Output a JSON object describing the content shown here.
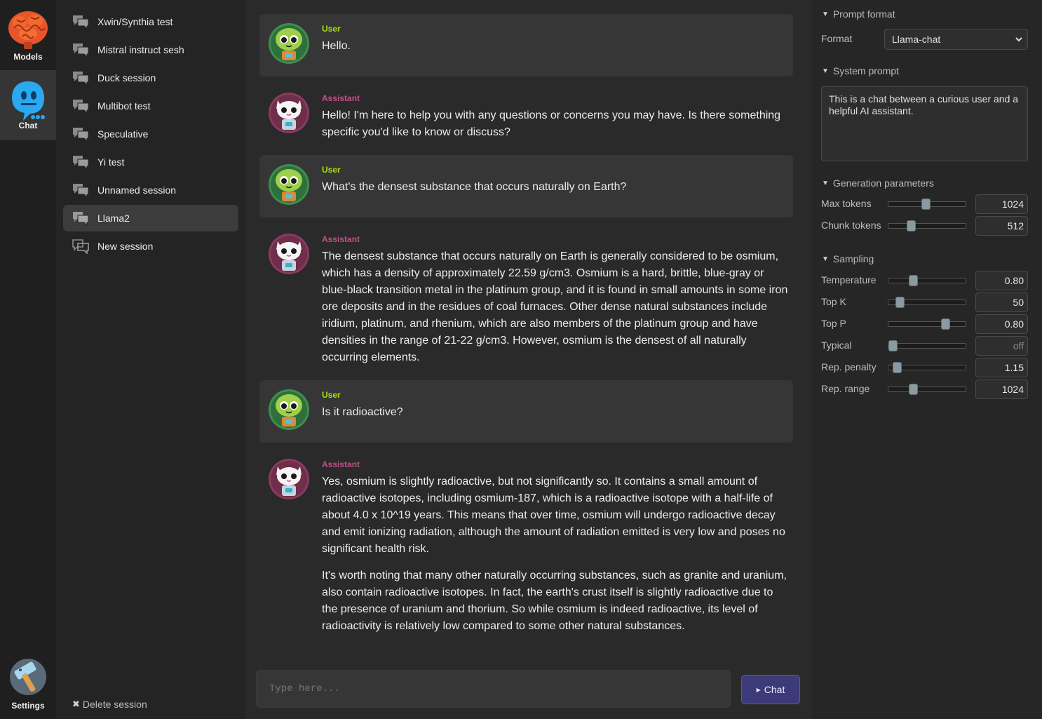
{
  "rail": {
    "models_label": "Models",
    "chat_label": "Chat",
    "settings_label": "Settings"
  },
  "sessions": {
    "items": [
      {
        "label": "Xwin/Synthia test"
      },
      {
        "label": "Mistral instruct sesh"
      },
      {
        "label": "Duck session"
      },
      {
        "label": "Multibot test"
      },
      {
        "label": "Speculative"
      },
      {
        "label": "Yi test"
      },
      {
        "label": "Unnamed session"
      },
      {
        "label": "Llama2"
      },
      {
        "label": "New session"
      }
    ],
    "active": "Llama2",
    "delete_label": "Delete session"
  },
  "chat": {
    "messages": [
      {
        "role": "User",
        "paragraphs": [
          "Hello."
        ]
      },
      {
        "role": "Assistant",
        "paragraphs": [
          "Hello! I'm here to help you with any questions or concerns you may have. Is there something specific you'd like to know or discuss?"
        ]
      },
      {
        "role": "User",
        "paragraphs": [
          "What's the densest substance that occurs naturally on Earth?"
        ]
      },
      {
        "role": "Assistant",
        "paragraphs": [
          "The densest substance that occurs naturally on Earth is generally considered to be osmium, which has a density of approximately 22.59 g/cm3. Osmium is a hard, brittle, blue-gray or blue-black transition metal in the platinum group, and it is found in small amounts in some iron ore deposits and in the residues of coal furnaces. Other dense natural substances include iridium, platinum, and rhenium, which are also members of the platinum group and have densities in the range of 21-22 g/cm3. However, osmium is the densest of all naturally occurring elements."
        ]
      },
      {
        "role": "User",
        "paragraphs": [
          "Is it radioactive?"
        ]
      },
      {
        "role": "Assistant",
        "paragraphs": [
          "Yes, osmium is slightly radioactive, but not significantly so. It contains a small amount of radioactive isotopes, including osmium-187, which is a radioactive isotope with a half-life of about 4.0 x 10^19 years. This means that over time, osmium will undergo radioactive decay and emit ionizing radiation, although the amount of radiation emitted is very low and poses no significant health risk.",
          "It's worth noting that many other naturally occurring substances, such as granite and uranium, also contain radioactive isotopes. In fact, the earth's crust itself is slightly radioactive due to the presence of uranium and thorium. So while osmium is indeed radioactive, its level of radioactivity is relatively low compared to some other natural substances."
        ]
      }
    ],
    "input_placeholder": "Type here...",
    "send_label": "Chat"
  },
  "settings": {
    "prompt_format": {
      "header": "Prompt format",
      "label": "Format",
      "value": "Llama-chat"
    },
    "system_prompt": {
      "header": "System prompt",
      "value": "This is a chat between a curious user and a helpful AI assistant."
    },
    "generation": {
      "header": "Generation parameters",
      "params": [
        {
          "label": "Max tokens",
          "value": "1024",
          "level": 0.48
        },
        {
          "label": "Chunk tokens",
          "value": "512",
          "level": 0.27
        }
      ]
    },
    "sampling": {
      "header": "Sampling",
      "params": [
        {
          "label": "Temperature",
          "value": "0.80",
          "level": 0.3
        },
        {
          "label": "Top K",
          "value": "50",
          "level": 0.1
        },
        {
          "label": "Top P",
          "value": "0.80",
          "level": 0.77
        },
        {
          "label": "Typical",
          "value": "off",
          "level": 0.0
        },
        {
          "label": "Rep. penalty",
          "value": "1.15",
          "level": 0.06
        },
        {
          "label": "Rep. range",
          "value": "1024",
          "level": 0.3
        }
      ]
    }
  },
  "colors": {
    "user_role": "#a8e014",
    "assistant_role": "#c0508a",
    "chat_button": "#3d3a7a"
  },
  "icons": {
    "models": "brain-icon",
    "chat": "chat-bot-icon",
    "settings": "hammer-icon",
    "session": "speech-bubbles-icon",
    "user_avatar": "green-robot-avatar",
    "assistant_avatar": "cat-robot-avatar"
  }
}
